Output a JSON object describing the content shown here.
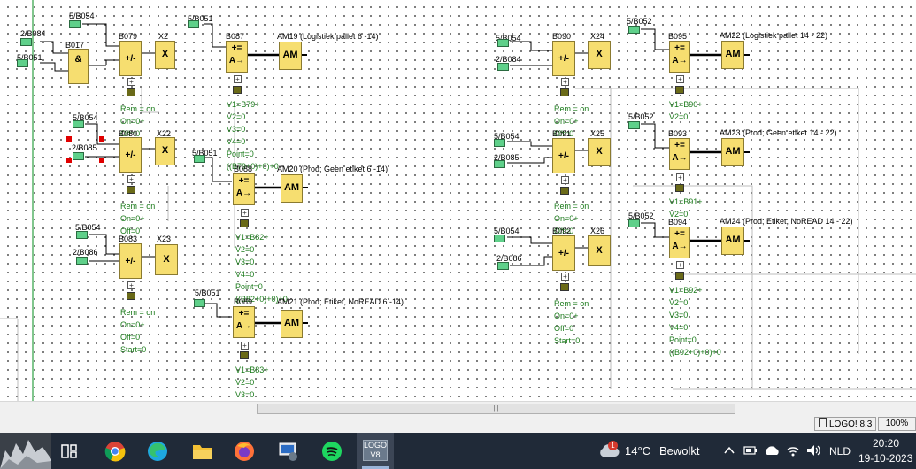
{
  "connectors": [
    {
      "id": "c1",
      "label": "5/B054"
    },
    {
      "id": "c2",
      "label": "2/B084"
    },
    {
      "id": "c3",
      "label": "5/B051"
    },
    {
      "id": "c4",
      "label": "5/B051"
    },
    {
      "id": "c5",
      "label": "5/B054"
    },
    {
      "id": "c6",
      "label": "2/B085"
    },
    {
      "id": "c7",
      "label": "5/B051"
    },
    {
      "id": "c8",
      "label": "5/B054"
    },
    {
      "id": "c9",
      "label": "2/B086"
    },
    {
      "id": "c10",
      "label": "5/B051"
    },
    {
      "id": "c11",
      "label": "5/B054"
    },
    {
      "id": "c12",
      "label": "2/B084"
    },
    {
      "id": "c13",
      "label": "5/B052"
    },
    {
      "id": "c14",
      "label": "5/B054"
    },
    {
      "id": "c15",
      "label": "2/B085"
    },
    {
      "id": "c16",
      "label": "5/B052"
    },
    {
      "id": "c17",
      "label": "5/B054"
    },
    {
      "id": "c18",
      "label": "2/B086"
    },
    {
      "id": "c19",
      "label": "5/B052"
    }
  ],
  "blocks": {
    "and": {
      "name": "B017",
      "symbol": "&"
    },
    "counters": [
      {
        "name": "B079",
        "symbol": "+/-",
        "out": "X2",
        "out_symbol": "X"
      },
      {
        "name": "B080",
        "symbol": "+/-",
        "out": "X22",
        "out_symbol": "X"
      },
      {
        "name": "B083",
        "symbol": "+/-",
        "out": "X23",
        "out_symbol": "X"
      },
      {
        "name": "B090",
        "symbol": "+/-",
        "out": "X24",
        "out_symbol": "X"
      },
      {
        "name": "B091",
        "symbol": "+/-",
        "out": "X25",
        "out_symbol": "X"
      },
      {
        "name": "B092",
        "symbol": "+/-",
        "out": "X26",
        "out_symbol": "X"
      }
    ],
    "math": [
      {
        "name": "B087",
        "symbol_top": "+=",
        "symbol_bot": "A→",
        "out": "AM19 (Logistiek pallet 6 -14)",
        "out_symbol": "AM"
      },
      {
        "name": "B088",
        "symbol_top": "+=",
        "symbol_bot": "A→",
        "out": "AM20 (Prod; Geen etiket 6 -14)",
        "out_symbol": "AM"
      },
      {
        "name": "B089",
        "symbol_top": "+=",
        "symbol_bot": "A→",
        "out": "AM21 (Prod; Etiket, NoREAD 6 -14)",
        "out_symbol": "AM"
      },
      {
        "name": "B095",
        "symbol_top": "+=",
        "symbol_bot": "A→",
        "out": "AM22 (Logistiek pallet 14 - 22)",
        "out_symbol": "AM"
      },
      {
        "name": "B093",
        "symbol_top": "+=",
        "symbol_bot": "A→",
        "out": "AM23 (Prod; Geen etiket 14 - 22)",
        "out_symbol": "AM"
      },
      {
        "name": "B094",
        "symbol_top": "+=",
        "symbol_bot": "A→",
        "out": "AM24 (Prod; Etiket, NoREAD 14 - 22)",
        "out_symbol": "AM"
      }
    ]
  },
  "counter_params": [
    "Rem = on",
    "On=0+",
    "Off=0",
    "Start=0"
  ],
  "math_params": {
    "B087": [
      "V1=B79+",
      "V2=0",
      "V3=0",
      "V4=0",
      "Point=0",
      "((B79+0)+0)+0"
    ],
    "B088": [
      "V1=B82+",
      "V2=0",
      "V3=0",
      "V4=0",
      "Point=0",
      "((B82+0)+0)+0"
    ],
    "B089": [
      "V1=B83+",
      "V2=0",
      "V3=0"
    ],
    "B095": [
      "V1=B90+",
      "V2=0",
      "V3=0",
      "V4=0",
      "Point=0",
      "((B90+0)+0)+0"
    ],
    "B093": [
      "V1=B91+",
      "V2=0",
      "V3=0",
      "V4=0",
      "Point=0",
      "((B91+0)+0)+0"
    ],
    "B094": [
      "V1=B92+",
      "V2=0",
      "V3=0",
      "V4=0",
      "Point=0",
      "((B92+0)+0)+0"
    ]
  },
  "statusbar": {
    "app_label": "LOGO! 8.3",
    "zoom": "100%"
  },
  "taskbar": {
    "weather_temp": "14°C",
    "weather_text": "Bewolkt",
    "weather_badge": "1",
    "language": "NLD",
    "time": "20:20",
    "date": "19-10-2023",
    "active_app_label_top": "LOGO",
    "active_app_label_bot": "V8",
    "scroll_grip": "|||"
  },
  "colors": {
    "block_fill": "#f6de70",
    "connector_fill": "#5fd08a",
    "param_text": "#1a7a1a",
    "taskbar": "#202a38",
    "selection": "#e00000"
  }
}
